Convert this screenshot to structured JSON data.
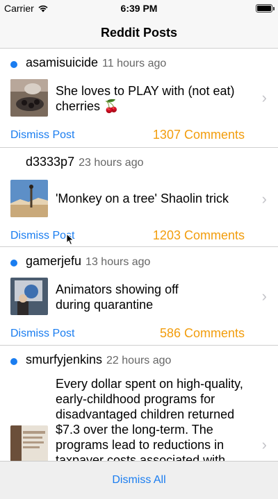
{
  "status_bar": {
    "carrier": "Carrier",
    "time": "6:39 PM",
    "wifi_icon": "wifi-icon",
    "battery_icon": "battery-icon"
  },
  "nav": {
    "title": "Reddit Posts"
  },
  "posts": [
    {
      "author": "asamisuicide",
      "time_ago": "11 hours ago",
      "unread": true,
      "title": "She loves to PLAY with (not eat) cherries 🍒",
      "comments": "1307 Comments",
      "dismiss_label": "Dismiss Post",
      "thumb_colors": [
        "#7a6a5c",
        "#3b3330",
        "#b8a79a"
      ]
    },
    {
      "author": "d3333p7",
      "time_ago": "23 hours ago",
      "unread": false,
      "title": "'Monkey on a tree' Shaolin trick",
      "comments": "1203 Comments",
      "dismiss_label": "Dismiss Post",
      "thumb_colors": [
        "#5d8fc7",
        "#c9a97a",
        "#e6d3b3"
      ]
    },
    {
      "author": "gamerjefu",
      "time_ago": "13 hours ago",
      "unread": true,
      "title": "Animators showing off during quarantine",
      "comments": "586 Comments",
      "dismiss_label": "Dismiss Post",
      "thumb_colors": [
        "#4a5b6e",
        "#c8cdd6",
        "#2e2a2a"
      ]
    },
    {
      "author": "smurfyjenkins",
      "time_ago": "22 hours ago",
      "unread": true,
      "title": "Every dollar spent on high-quality, early-childhood programs for disadvantaged children returned $7.3 over the long-term. The programs lead to reductions in taxpayer costs associated with",
      "comments": "",
      "dismiss_label": "",
      "thumb_colors": [
        "#e8e1d6",
        "#6b4f3a",
        "#b09a84"
      ]
    }
  ],
  "footer": {
    "dismiss_all_label": "Dismiss All"
  },
  "colors": {
    "accent": "#1a7df0",
    "comments": "#f29d0d"
  }
}
